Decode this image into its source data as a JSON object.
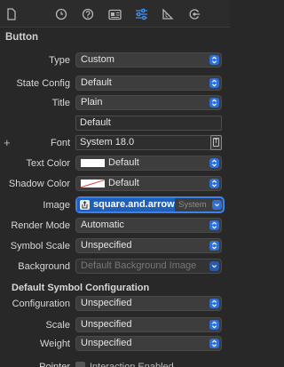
{
  "toolbar": {
    "icons": [
      "file-inspector-icon",
      "history-inspector-icon",
      "quick-help-icon",
      "identity-inspector-icon",
      "attributes-inspector-icon",
      "size-inspector-icon",
      "connections-inspector-icon"
    ],
    "active_icon": "attributes-inspector-icon",
    "accent_color": "#3d8ff7"
  },
  "section": {
    "title": "Button"
  },
  "rows": {
    "type": {
      "label": "Type",
      "value": "Custom"
    },
    "state_config": {
      "label": "State Config",
      "value": "Default"
    },
    "title": {
      "label": "Title",
      "value": "Plain"
    },
    "title_text": {
      "value": "Default"
    },
    "font": {
      "label": "Font",
      "value": "System 18.0"
    },
    "text_color": {
      "label": "Text Color",
      "value": "Default",
      "swatch": "#ffffff"
    },
    "shadow_color": {
      "label": "Shadow Color",
      "value": "Default",
      "swatch": "none"
    },
    "image": {
      "label": "Image",
      "value": "square.and.arrow",
      "badge": "System"
    },
    "render_mode": {
      "label": "Render Mode",
      "value": "Automatic"
    },
    "symbol_scale": {
      "label": "Symbol Scale",
      "value": "Unspecified"
    },
    "background": {
      "label": "Background",
      "placeholder": "Default Background Image"
    }
  },
  "symbol_config": {
    "title": "Default Symbol Configuration",
    "configuration": {
      "label": "Configuration",
      "value": "Unspecified"
    },
    "scale": {
      "label": "Scale",
      "value": "Unspecified"
    },
    "weight": {
      "label": "Weight",
      "value": "Unspecified"
    }
  },
  "pointer": {
    "label": "Pointer",
    "checkbox_label": "Interaction Enabled"
  }
}
